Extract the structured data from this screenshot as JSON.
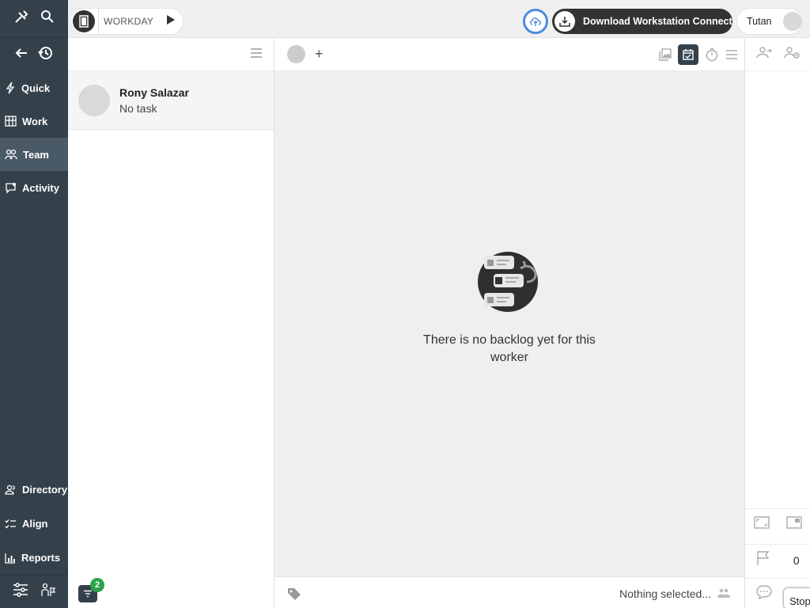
{
  "nav": {
    "items": [
      {
        "label": "Quick",
        "icon": "bolt-icon"
      },
      {
        "label": "Work",
        "icon": "board-icon"
      },
      {
        "label": "Team",
        "icon": "team-icon",
        "active": true
      },
      {
        "label": "Activity",
        "icon": "activity-icon"
      }
    ],
    "bottom_items": [
      {
        "label": "Directory",
        "icon": "people-icon"
      },
      {
        "label": "Align",
        "icon": "checklist-icon"
      },
      {
        "label": "Reports",
        "icon": "bar-chart-icon"
      }
    ]
  },
  "topbar": {
    "workday_label": "WORKDAY",
    "download_label": "Download Workstation Connect",
    "user_name": "Tutan"
  },
  "workers": [
    {
      "name": "Rony Salazar",
      "task": "No task"
    }
  ],
  "filter": {
    "badge_count": "2"
  },
  "center": {
    "add_label": "+",
    "empty_message": "There is no backlog yet for this worker"
  },
  "footer": {
    "selection_text": "Nothing selected..."
  },
  "right": {
    "flag_count": "0",
    "stop_label": "Stop"
  },
  "colors": {
    "nav_bg": "#34414b",
    "nav_active": "#4a5966",
    "badge": "#2aa34a",
    "cloud_ring": "#4a8ce0"
  }
}
